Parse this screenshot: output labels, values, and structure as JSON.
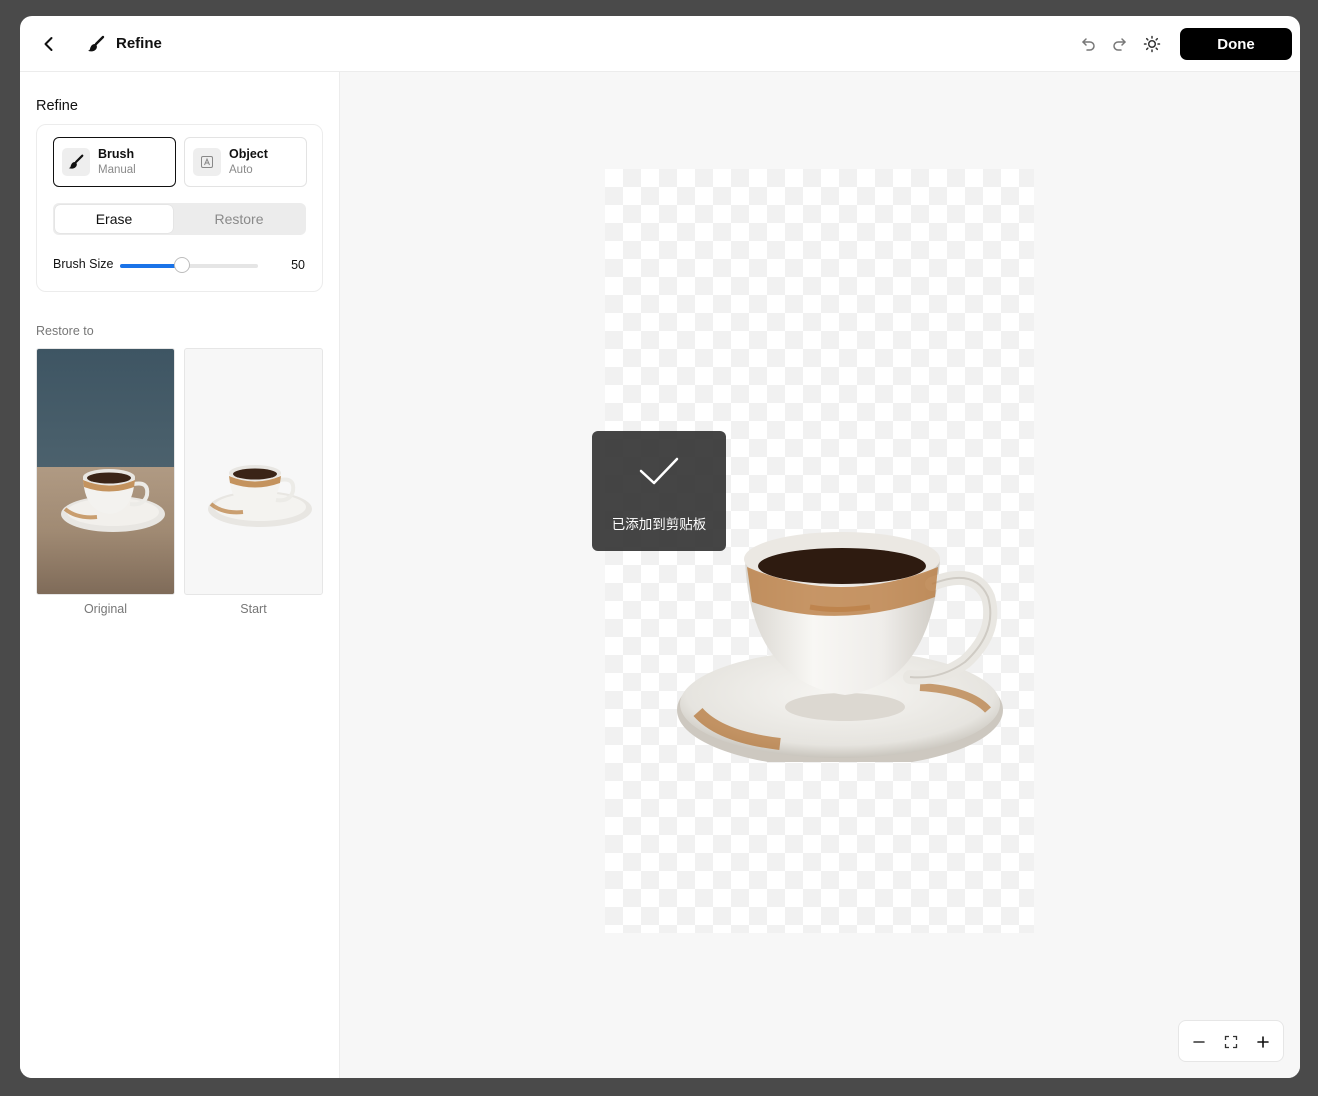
{
  "header": {
    "title": "Refine",
    "done_label": "Done"
  },
  "sidebar": {
    "title": "Refine",
    "modes": [
      {
        "label": "Brush",
        "sub": "Manual",
        "icon": "brush-icon"
      },
      {
        "label": "Object",
        "sub": "Auto",
        "icon": "object-auto-icon"
      }
    ],
    "segment": {
      "erase": "Erase",
      "restore": "Restore"
    },
    "brush_size": {
      "label": "Brush Size",
      "value": "50",
      "fraction": 0.45
    },
    "restore_to": {
      "label": "Restore to",
      "options": [
        {
          "caption": "Original"
        },
        {
          "caption": "Start"
        }
      ]
    }
  },
  "toast": {
    "text": "已添加到剪贴板",
    "icon": "checkmark-icon"
  },
  "colors": {
    "accent": "#1a73e8",
    "done_bg": "#000000",
    "canvas_bg": "#f7f7f7"
  }
}
